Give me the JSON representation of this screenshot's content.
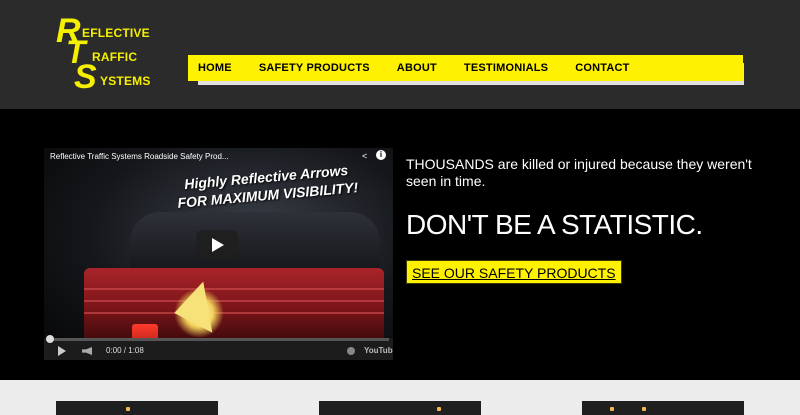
{
  "logo": {
    "initials": [
      "R",
      "T",
      "S"
    ],
    "words": [
      "EFLECTIVE",
      "RAFFIC",
      "YSTEMS"
    ]
  },
  "nav": {
    "items": [
      "HOME",
      "SAFETY PRODUCTS",
      "ABOUT",
      "TESTIMONIALS",
      "CONTACT"
    ]
  },
  "video": {
    "title": "Reflective Traffic Systems Roadside Safety Prod...",
    "overlay_line1": "Highly Reflective Arrows",
    "overlay_line2": "FOR MAXIMUM VISIBILITY!",
    "time": "0:00 / 1:08",
    "youtube_label": "YouTube"
  },
  "hero": {
    "tagline": "THOUSANDS are killed or injured because they weren't seen in time.",
    "headline": "DON'T BE A STATISTIC.",
    "cta": "SEE OUR SAFETY PRODUCTS"
  },
  "colors": {
    "accent": "#fff200",
    "header_bg": "#2b2b2b",
    "hero_bg": "#000000",
    "page_bg": "#ececec"
  },
  "icons": [
    "play-icon",
    "share-icon",
    "info-icon",
    "volume-icon",
    "settings-icon"
  ]
}
